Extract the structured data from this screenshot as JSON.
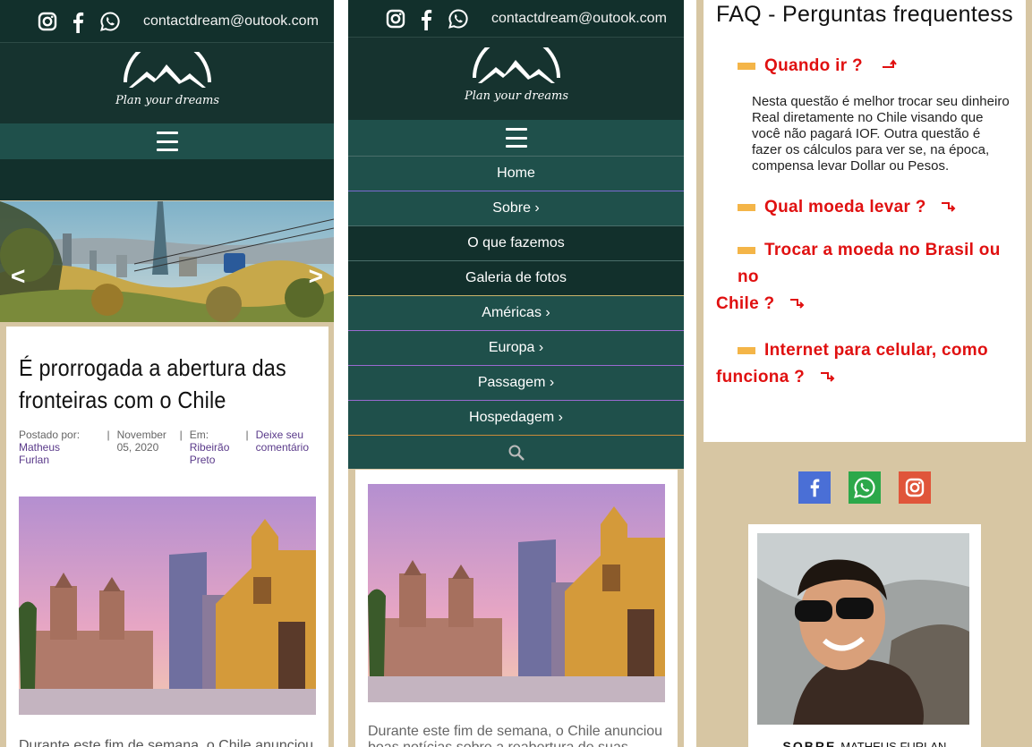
{
  "header": {
    "email": "contactdream@outook.com",
    "logo_text": "Plan your dreams"
  },
  "nav": {
    "items": [
      {
        "label": "Home"
      },
      {
        "label": "Sobre ›"
      },
      {
        "label": "O que fazemos"
      },
      {
        "label": "Galeria de fotos"
      },
      {
        "label": "Américas ›"
      },
      {
        "label": "Europa ›"
      },
      {
        "label": "Passagem ›"
      },
      {
        "label": "Hospedagem ›"
      }
    ]
  },
  "slider": {
    "prev": "<",
    "next": ">"
  },
  "post": {
    "title": "É prorrogada a abertura das fronteiras com o Chile",
    "posted_by_label": "Postado por:",
    "author": "Matheus Furlan",
    "date": "November 05, 2020",
    "em_label": "Em:",
    "location": "Ribeirão Preto",
    "comment_link": "Deixe seu comentário",
    "excerpt_p1": "Durante este fim de semana, o Chile anunciou",
    "excerpt_p2_l1": "Durante este fim de semana, o Chile anunciou",
    "excerpt_p2_l2": "boas notícias sobre a reabertura de suas"
  },
  "faq": {
    "title": "FAQ - Perguntas frequentess",
    "q1": "Quando ir ?",
    "a1": "Nesta questão é melhor trocar seu dinheiro Real diretamente no Chile visando que você não pagará IOF. Outra questão é fazer os cálculos para ver se, na época, compensa levar Dollar ou Pesos.",
    "q2": "Qual moeda levar ?",
    "q3_l1": "Trocar a moeda no Brasil ou no",
    "q3_l2": "Chile ?",
    "q4_l1": "Internet para celular, como",
    "q4_l2": "funciona ?"
  },
  "about": {
    "label_bold": "SOBRE",
    "label_name": "MATHEUS FURLAN"
  },
  "colors": {
    "topbar": "#12302c",
    "menubar": "#1f504b",
    "faq_red": "#e01010",
    "faq_bar": "#f4b548",
    "link_purple": "#5a3a8a",
    "facebook": "#4a6fd6",
    "whatsapp": "#2ca84a",
    "instagram": "#e0553a"
  },
  "icons": [
    "instagram-icon",
    "facebook-icon",
    "whatsapp-icon",
    "hamburger-icon",
    "search-icon",
    "arrow-icon"
  ]
}
